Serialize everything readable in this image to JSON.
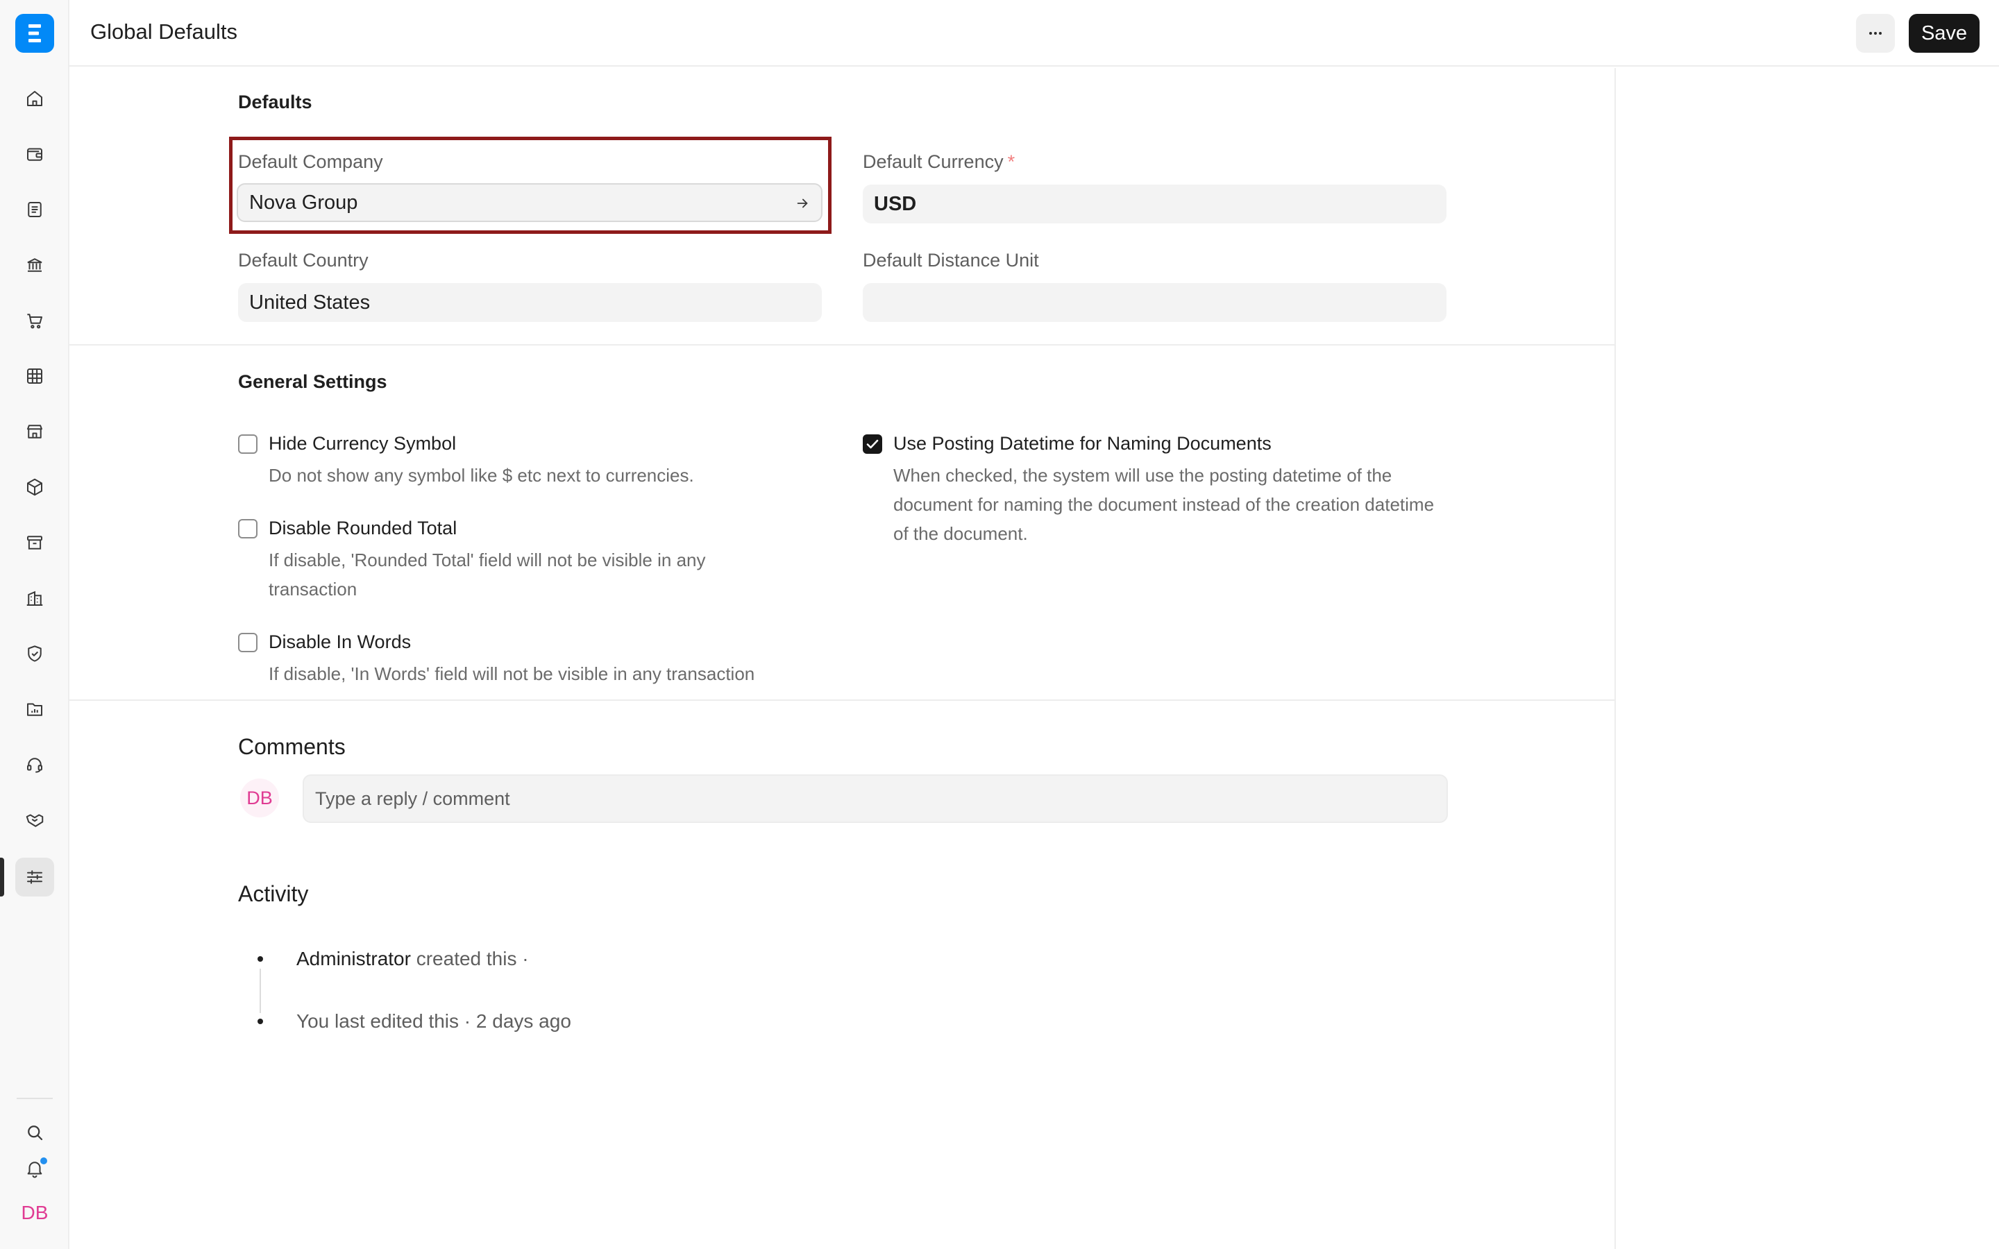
{
  "header": {
    "title": "Global Defaults",
    "more_label": "···",
    "save_label": "Save"
  },
  "sidebar": {
    "items": [
      {
        "icon": "home-icon"
      },
      {
        "icon": "wallet-icon"
      },
      {
        "icon": "document-icon"
      },
      {
        "icon": "bank-icon"
      },
      {
        "icon": "cart-icon"
      },
      {
        "icon": "table-icon"
      },
      {
        "icon": "store-icon"
      },
      {
        "icon": "package-icon"
      },
      {
        "icon": "archive-icon"
      },
      {
        "icon": "building-icon"
      },
      {
        "icon": "shield-check-icon"
      },
      {
        "icon": "folder-chart-icon"
      },
      {
        "icon": "headset-icon"
      },
      {
        "icon": "handshake-icon"
      },
      {
        "icon": "sliders-icon"
      }
    ],
    "active_icon": "sliders-icon",
    "user_initials": "DB"
  },
  "defaults_section": {
    "title": "Defaults",
    "default_company": {
      "label": "Default Company",
      "value": "Nova Group"
    },
    "default_currency": {
      "label": "Default Currency",
      "required_mark": "*",
      "value": "USD"
    },
    "default_country": {
      "label": "Default Country",
      "value": "United States"
    },
    "default_distance_unit": {
      "label": "Default Distance Unit",
      "value": ""
    }
  },
  "general_settings": {
    "title": "General Settings",
    "hide_currency_symbol": {
      "label": "Hide Currency Symbol",
      "description": "Do not show any symbol like $ etc next to currencies.",
      "checked": false
    },
    "disable_rounded_total": {
      "label": "Disable Rounded Total",
      "description": "If disable, 'Rounded Total' field will not be visible in any transaction",
      "checked": false
    },
    "disable_in_words": {
      "label": "Disable In Words",
      "description": "If disable, 'In Words' field will not be visible in any transaction",
      "checked": false
    },
    "use_posting_datetime": {
      "label": "Use Posting Datetime for Naming Documents",
      "description": "When checked, the system will use the posting datetime of the document for naming the document instead of the creation datetime of the document.",
      "checked": true
    }
  },
  "comments": {
    "title": "Comments",
    "avatar_initials": "DB",
    "placeholder": "Type a reply / comment"
  },
  "activity": {
    "title": "Activity",
    "entries": [
      {
        "actor": "Administrator",
        "text": "created this ·"
      },
      {
        "actor": "",
        "text": "You last edited this · 2 days ago"
      }
    ]
  },
  "colors": {
    "brand": "#0289f7",
    "primary_button": "#171717",
    "highlight": "#8e1a1a",
    "avatar": "#e03c93",
    "notification_dot": "#2490ef"
  }
}
